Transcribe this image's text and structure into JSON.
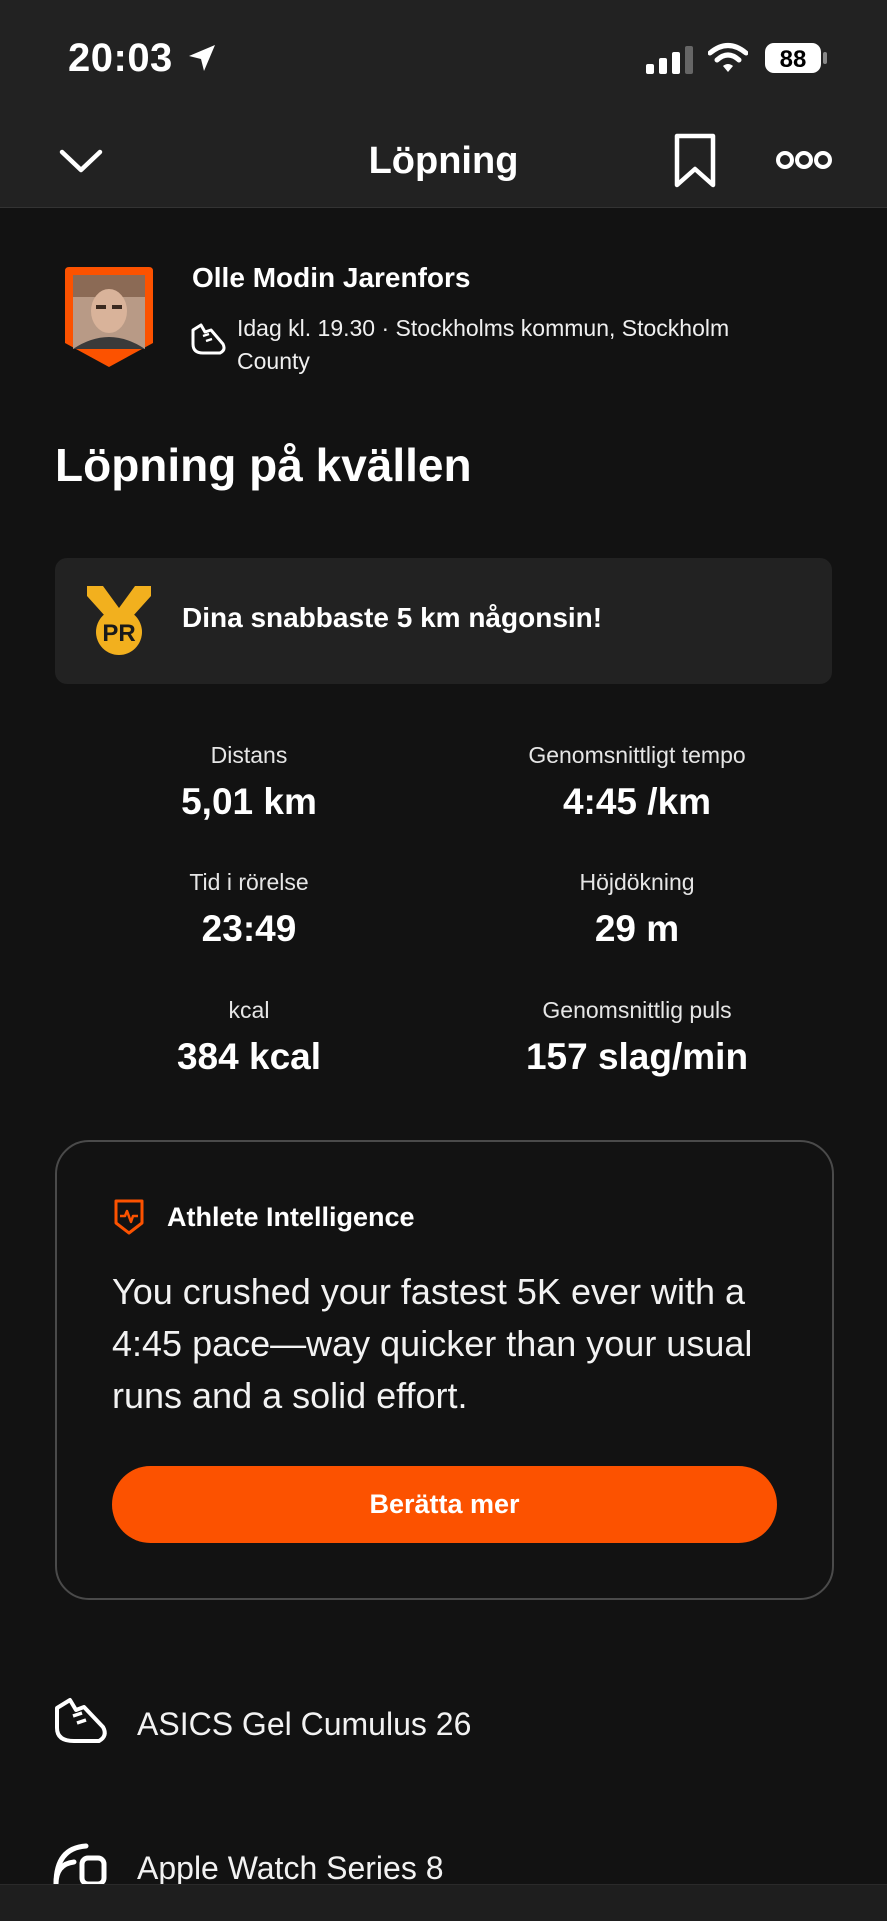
{
  "status_bar": {
    "time": "20:03",
    "battery": "88"
  },
  "nav": {
    "title": "Löpning"
  },
  "athlete": {
    "name": "Olle Modin Jarenfors",
    "meta": "Idag kl. 19.30 · Stockholms kommun, Stockholm County"
  },
  "activity": {
    "title": "Löpning på kvällen"
  },
  "pr_banner": {
    "badge": "PR",
    "text": "Dina snabbaste 5 km någonsin!"
  },
  "stats": [
    {
      "label": "Distans",
      "value": "5,01 km"
    },
    {
      "label": "Genomsnittligt tempo",
      "value": "4:45 /km"
    },
    {
      "label": "Tid i rörelse",
      "value": "23:49"
    },
    {
      "label": "Höjdökning",
      "value": "29 m"
    },
    {
      "label": "kcal",
      "value": "384 kcal"
    },
    {
      "label": "Genomsnittlig puls",
      "value": "157 slag/min"
    }
  ],
  "athlete_intelligence": {
    "title": "Athlete Intelligence",
    "text": "You crushed your fastest 5K ever with a 4:45 pace—way quicker than your usual runs and a solid effort.",
    "button": "Berätta mer"
  },
  "gear": {
    "shoe": "ASICS Gel Cumulus 26",
    "device": "Apple Watch Series 8"
  },
  "colors": {
    "accent": "#fc5200",
    "background": "#121212",
    "card": "#222222",
    "pr_gold": "#f2b01e"
  },
  "icons": [
    "location-arrow-icon",
    "signal-icon",
    "wifi-icon",
    "battery-icon",
    "chevron-down-icon",
    "bookmark-icon",
    "more-icon",
    "shoe-icon",
    "pr-medal-icon",
    "athlete-intelligence-icon",
    "watch-icon"
  ]
}
